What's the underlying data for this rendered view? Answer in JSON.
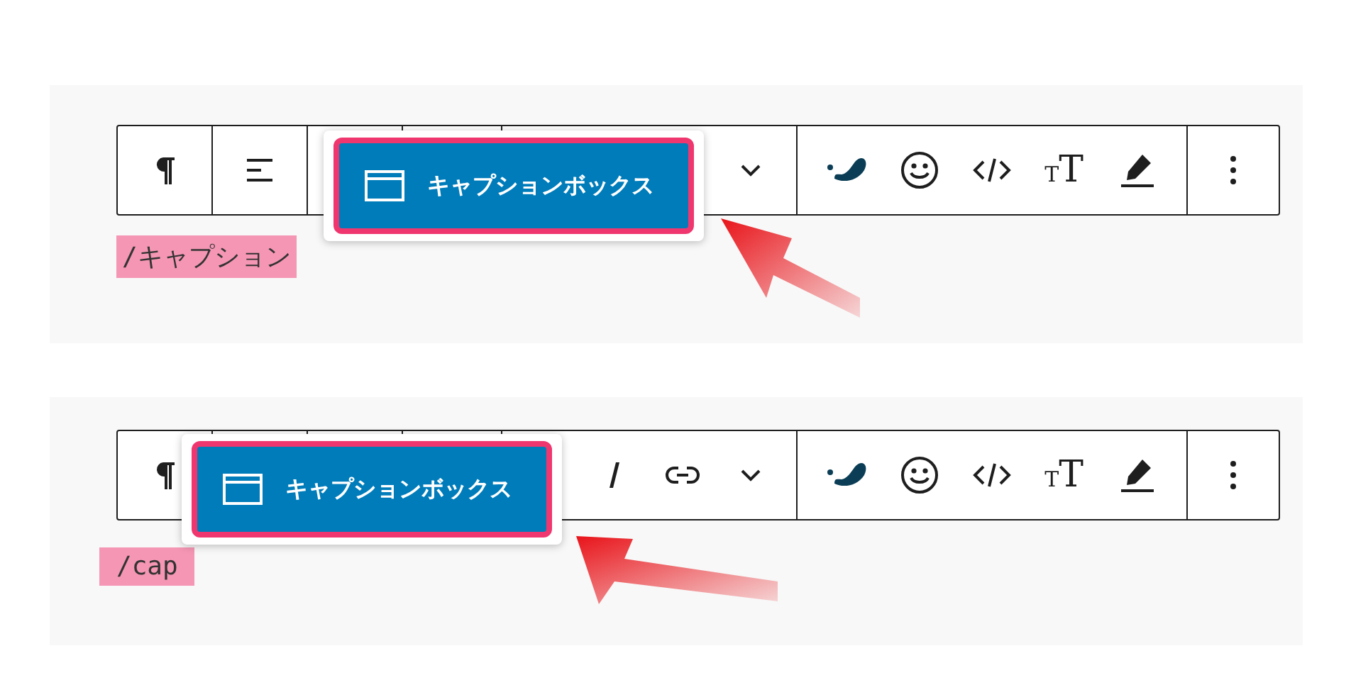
{
  "panels": [
    {
      "toolbar": {
        "block_buttons": [
          {
            "kind": "paragraph"
          },
          {
            "kind": "align"
          }
        ],
        "tools": [
          {
            "kind": "brush"
          },
          {
            "kind": "emoji"
          },
          {
            "kind": "code"
          },
          {
            "kind": "text-size",
            "glyphs": [
              "T",
              "T"
            ]
          },
          {
            "kind": "highlighter"
          }
        ]
      },
      "popup": {
        "label": "キャプションボックス"
      },
      "typed_text": "/キャプション"
    },
    {
      "toolbar": {
        "block_buttons": [
          {
            "kind": "paragraph"
          }
        ],
        "format_buttons": [
          {
            "kind": "italic"
          },
          {
            "kind": "link"
          }
        ],
        "tools": [
          {
            "kind": "brush"
          },
          {
            "kind": "emoji"
          },
          {
            "kind": "code"
          },
          {
            "kind": "text-size",
            "glyphs": [
              "T",
              "T"
            ]
          },
          {
            "kind": "highlighter"
          }
        ]
      },
      "popup": {
        "label": "キャプションボックス"
      },
      "typed_text": "/cap"
    }
  ]
}
